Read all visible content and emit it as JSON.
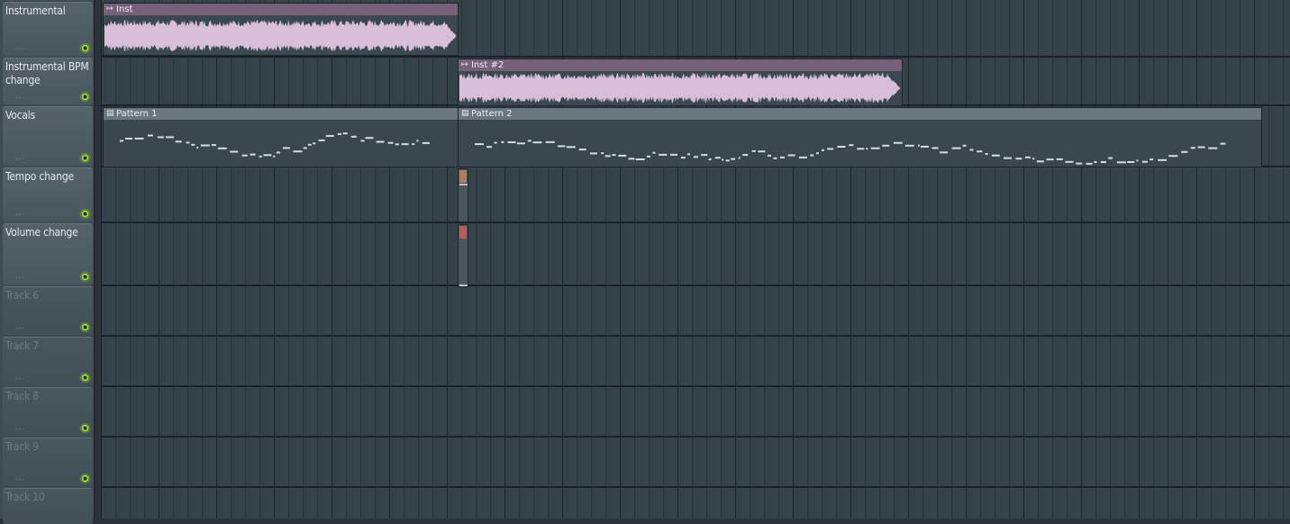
{
  "tracks": [
    {
      "name": "Instrumental",
      "dots": "...",
      "active": true
    },
    {
      "name": "Instrumental BPM change",
      "dots": "...",
      "active": true
    },
    {
      "name": "Vocals",
      "dots": "...",
      "active": true
    },
    {
      "name": "Tempo change",
      "dots": "...",
      "active": true
    },
    {
      "name": "Volume change",
      "dots": "...",
      "active": true
    },
    {
      "name": "Track 6",
      "dots": "...",
      "active": false
    },
    {
      "name": "Track 7",
      "dots": "...",
      "active": false
    },
    {
      "name": "Track 8",
      "dots": "...",
      "active": false
    },
    {
      "name": "Track 9",
      "dots": "...",
      "active": false
    },
    {
      "name": "Track 10",
      "dots": "...",
      "active": false
    }
  ],
  "clips": {
    "inst": {
      "title": "Inst",
      "icon": "audio-clip-icon"
    },
    "inst2": {
      "title": "Inst #2",
      "icon": "audio-clip-icon"
    },
    "pattern1": {
      "title": "Pattern 1",
      "icon": "pattern-clip-icon"
    },
    "pattern2": {
      "title": "Pattern 2",
      "icon": "pattern-clip-icon"
    }
  },
  "colors": {
    "audio_clip_header": "#76607a",
    "waveform": "#d7bfd9",
    "pattern_header": "#6a777f",
    "note": "#d6dde2",
    "led": "#a8e33a",
    "tempo_automation": "#b07c5e",
    "volume_automation": "#b85a5e"
  }
}
